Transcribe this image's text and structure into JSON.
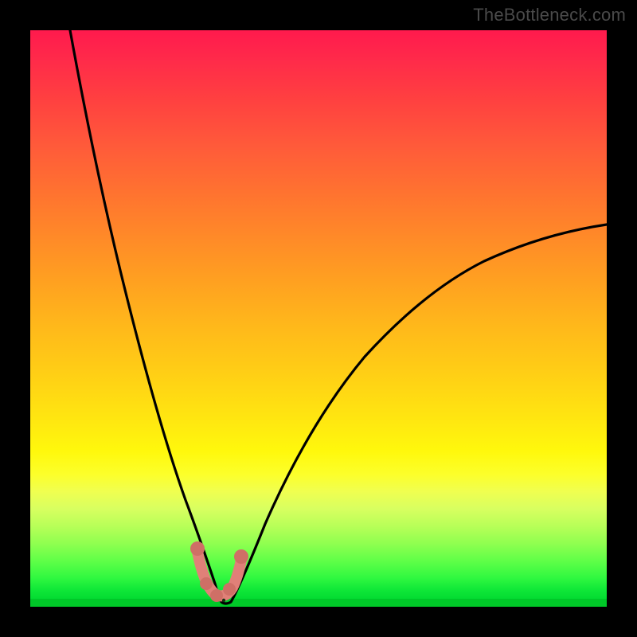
{
  "watermark": "TheBottleneck.com",
  "colors": {
    "background": "#000000",
    "curve": "#000000",
    "marker": "#e08078",
    "markerPoint": "#cf6f66",
    "baseline": "#00c828"
  },
  "chart_data": {
    "type": "line",
    "title": "",
    "xlabel": "",
    "ylabel": "",
    "xlim": [
      0,
      100
    ],
    "ylim": [
      0,
      100
    ],
    "series": [
      {
        "name": "bottleneck-curve",
        "x": [
          7,
          10,
          13,
          15,
          17,
          19,
          21,
          23,
          25,
          27,
          29,
          30,
          31,
          32.5,
          36,
          40,
          45,
          50,
          55,
          60,
          65,
          70,
          75,
          80,
          85,
          90,
          95,
          100
        ],
        "y": [
          100,
          90,
          80,
          73,
          66,
          58,
          50,
          42,
          34,
          26,
          17,
          10,
          4,
          0,
          4,
          10,
          18,
          25,
          31,
          36,
          41,
          45,
          49,
          52,
          55,
          58,
          60.5,
          62.5
        ]
      }
    ],
    "annotations": [
      {
        "type": "marker-point",
        "x": 29,
        "y": 10
      },
      {
        "type": "marker-point",
        "x": 36,
        "y": 10
      },
      {
        "type": "marker-point",
        "x": 30.5,
        "y": 4
      },
      {
        "type": "marker-point",
        "x": 32,
        "y": 1.5
      },
      {
        "type": "marker-point",
        "x": 34,
        "y": 4
      }
    ],
    "minimum": {
      "x": 32.5,
      "y": 0
    },
    "note": "Values estimated from pixel positions; x and y are in percent of plot-area width/height, y measured as distance above bottom baseline (0 = bottom, 100 = top)."
  }
}
